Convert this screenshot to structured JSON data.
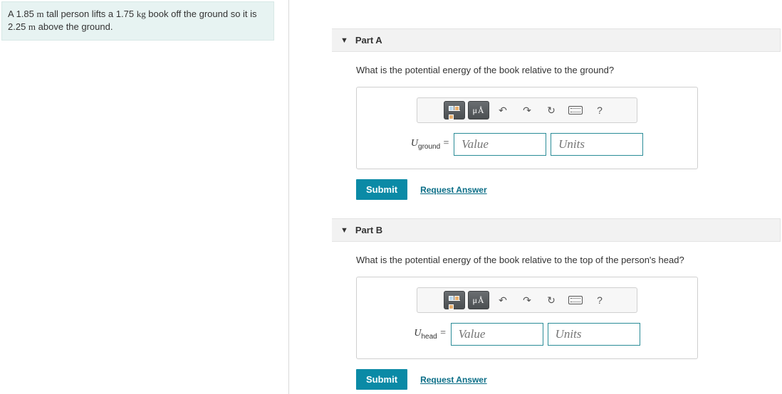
{
  "problem": {
    "html_segments": [
      "A 1.85 ",
      "m",
      " tall person lifts a 1.75 ",
      "kg",
      " book off the ground so it is 2.25 ",
      "m",
      " above the ground."
    ]
  },
  "toolbar": {
    "mu_a": "μÅ",
    "undo": "↶",
    "redo": "↷",
    "reset": "↻",
    "help": "?"
  },
  "parts": [
    {
      "label": "Part A",
      "question": "What is the potential energy of the book relative to the ground?",
      "var_letter": "U",
      "var_sub": "ground",
      "eq": " = ",
      "value_ph": "Value",
      "units_ph": "Units",
      "submit": "Submit",
      "request": "Request Answer"
    },
    {
      "label": "Part B",
      "question": "What is the potential energy of the book relative to the top of the person's head?",
      "var_letter": "U",
      "var_sub": "head",
      "eq": " = ",
      "value_ph": "Value",
      "units_ph": "Units",
      "submit": "Submit",
      "request": "Request Answer"
    }
  ]
}
